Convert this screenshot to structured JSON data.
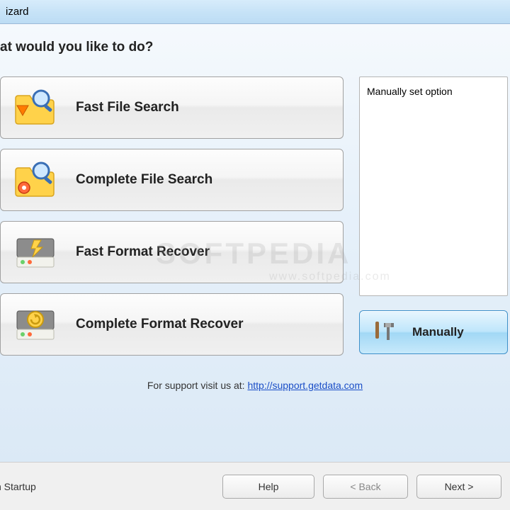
{
  "titlebar": {
    "title": "izard"
  },
  "question": "at would you like to do?",
  "options": [
    {
      "label": "Fast File Search",
      "icon": "folder-search"
    },
    {
      "label": "Complete File Search",
      "icon": "folder-search-full"
    },
    {
      "label": "Fast Format Recover",
      "icon": "drive-lightning"
    },
    {
      "label": "Complete Format Recover",
      "icon": "drive-recover"
    }
  ],
  "info_panel": {
    "text": "Manually set option"
  },
  "manual_button": {
    "label": "Manually"
  },
  "support": {
    "prefix": "For support visit us at:  ",
    "link_text": "http://support.getdata.com"
  },
  "footer": {
    "startup_label": "n Startup",
    "help": "Help",
    "back": "< Back",
    "next": "Next >"
  },
  "watermark": {
    "main": "SOFTPEDIA",
    "sub": "www.softpedia.com"
  }
}
